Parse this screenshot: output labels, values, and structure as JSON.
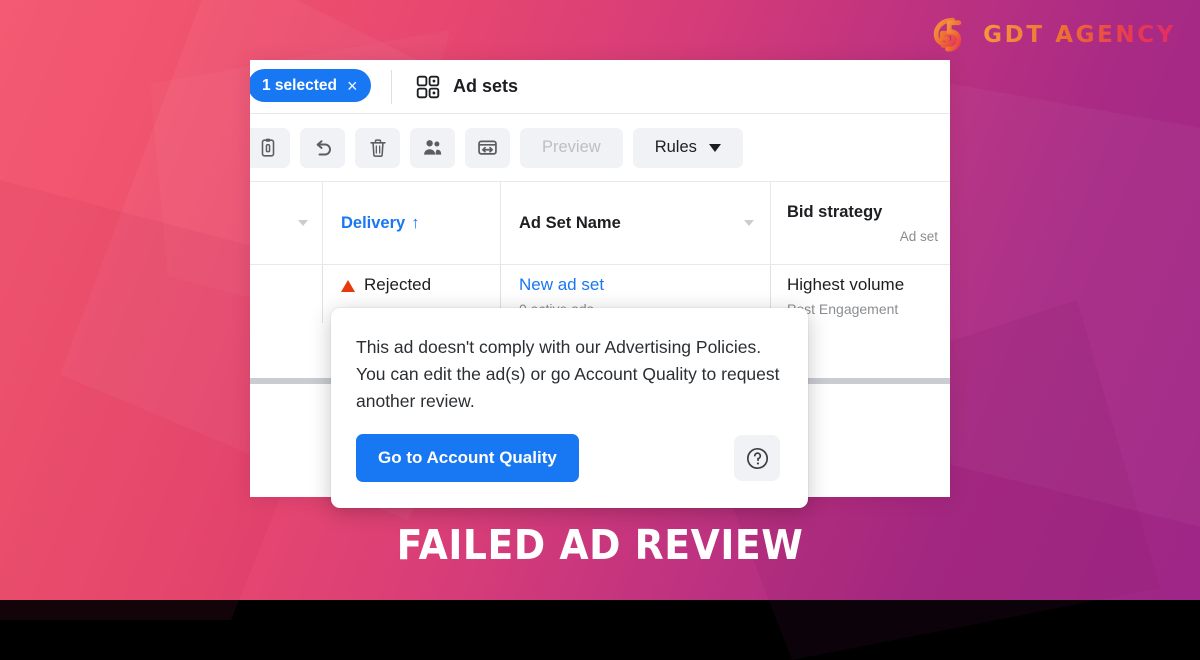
{
  "background": {
    "gradient_from": "#F45A73",
    "gradient_to": "#9E2686"
  },
  "logo": {
    "mark_name": "gdt-monogram",
    "wordmark": "GDT AGENCY",
    "gradient_from": "#F9A13A",
    "gradient_to": "#E82E63"
  },
  "caption": {
    "text": "FAILED AD REVIEW",
    "color": "#FFFFFF"
  },
  "screenshot": {
    "topbar": {
      "selection_chip": {
        "label": "1 selected",
        "close_glyph": "×",
        "color": "#1877F2"
      },
      "section": {
        "icon": "grid-squares-icon",
        "title": "Ad sets"
      }
    },
    "toolbar": {
      "icon_buttons": [
        {
          "name": "duplicate-button",
          "icon": "clipboard-icon"
        },
        {
          "name": "revert-button",
          "icon": "undo-arrow-icon"
        },
        {
          "name": "delete-button",
          "icon": "trash-icon"
        },
        {
          "name": "audience-button",
          "icon": "people-icon"
        },
        {
          "name": "ab-test-button",
          "icon": "ab-test-icon"
        }
      ],
      "preview_label": "Preview",
      "preview_disabled": true,
      "rules_label": "Rules"
    },
    "table": {
      "columns": [
        {
          "key": "select",
          "label": "",
          "sub": "",
          "has_caret": true,
          "sorted": false,
          "link": false
        },
        {
          "key": "delivery",
          "label": "Delivery",
          "sub": "",
          "has_caret": false,
          "sorted": true,
          "sort_glyph": "↑",
          "link": true
        },
        {
          "key": "name",
          "label": "Ad Set Name",
          "sub": "",
          "has_caret": true,
          "sorted": false,
          "link": false
        },
        {
          "key": "bid",
          "label": "Bid strategy",
          "sub": "Ad set",
          "has_caret": false,
          "sorted": false,
          "link": false
        }
      ],
      "rows": [
        {
          "delivery_status": "Rejected",
          "delivery_icon": "red-warning-triangle-icon",
          "delivery_icon_color": "#E8390E",
          "ad_set_name": "New ad set",
          "ad_set_sub": "0 active ads",
          "bid_strategy": "Highest volume",
          "bid_sub": "Post Engagement",
          "selected": true
        }
      ]
    },
    "popover": {
      "message": "This ad doesn't comply with our Advertising Policies. You can edit the ad(s) or go Account Quality to request another review.",
      "primary_button": "Go to Account Quality",
      "primary_color": "#1877F2",
      "help_icon": "question-circle-icon"
    }
  }
}
